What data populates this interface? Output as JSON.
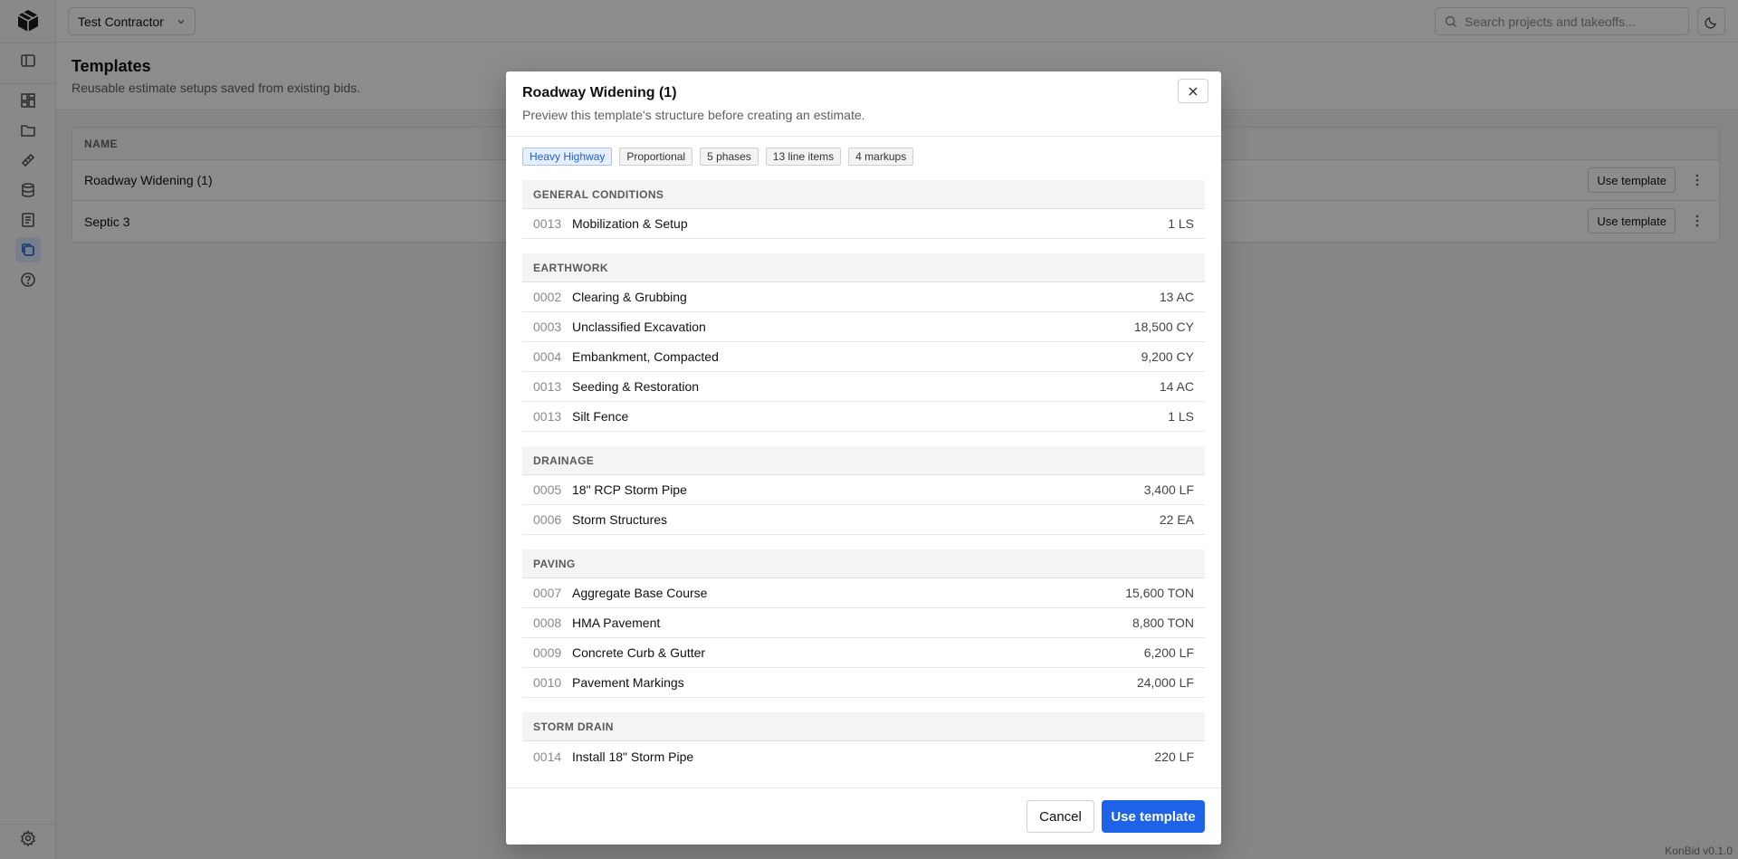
{
  "org": {
    "name": "Test Contractor"
  },
  "search": {
    "placeholder": "Search projects and takeoffs..."
  },
  "page": {
    "title": "Templates",
    "subtitle": "Reusable estimate setups saved from existing bids."
  },
  "table": {
    "header_name": "NAME",
    "rows": [
      {
        "name": "Roadway Widening (1)",
        "action": "Use template"
      },
      {
        "name": "Septic 3",
        "action": "Use template"
      }
    ]
  },
  "version": "KonBid v0.1.0",
  "modal": {
    "title": "Roadway Widening (1)",
    "description": "Preview this template's structure before creating an estimate.",
    "tags": [
      "Heavy Highway",
      "Proportional",
      "5 phases",
      "13 line items",
      "4 markups"
    ],
    "phases": [
      {
        "name": "GENERAL CONDITIONS",
        "lines": [
          {
            "code": "0013",
            "desc": "Mobilization & Setup",
            "qty": "1 LS"
          }
        ]
      },
      {
        "name": "EARTHWORK",
        "lines": [
          {
            "code": "0002",
            "desc": "Clearing & Grubbing",
            "qty": "13 AC"
          },
          {
            "code": "0003",
            "desc": "Unclassified Excavation",
            "qty": "18,500 CY"
          },
          {
            "code": "0004",
            "desc": "Embankment, Compacted",
            "qty": "9,200 CY"
          },
          {
            "code": "0013",
            "desc": "Seeding & Restoration",
            "qty": "14 AC"
          },
          {
            "code": "0013",
            "desc": "Silt Fence",
            "qty": "1 LS"
          }
        ]
      },
      {
        "name": "DRAINAGE",
        "lines": [
          {
            "code": "0005",
            "desc": "18\" RCP Storm Pipe",
            "qty": "3,400 LF"
          },
          {
            "code": "0006",
            "desc": "Storm Structures",
            "qty": "22 EA"
          }
        ]
      },
      {
        "name": "PAVING",
        "lines": [
          {
            "code": "0007",
            "desc": "Aggregate Base Course",
            "qty": "15,600 TON"
          },
          {
            "code": "0008",
            "desc": "HMA Pavement",
            "qty": "8,800 TON"
          },
          {
            "code": "0009",
            "desc": "Concrete Curb & Gutter",
            "qty": "6,200 LF"
          },
          {
            "code": "0010",
            "desc": "Pavement Markings",
            "qty": "24,000 LF"
          }
        ]
      },
      {
        "name": "STORM DRAIN",
        "lines": [
          {
            "code": "0014",
            "desc": "Install 18\" Storm Pipe",
            "qty": "220 LF"
          }
        ]
      }
    ],
    "cancel_label": "Cancel",
    "confirm_label": "Use template"
  },
  "colors": {
    "accent": "#1e62e8",
    "overlay": "rgba(0,0,0,0.45)"
  },
  "icons": {
    "sidebar": [
      "dashboard-icon",
      "folder-icon",
      "ruler-icon",
      "database-icon",
      "document-icon",
      "templates-icon",
      "help-icon"
    ]
  }
}
